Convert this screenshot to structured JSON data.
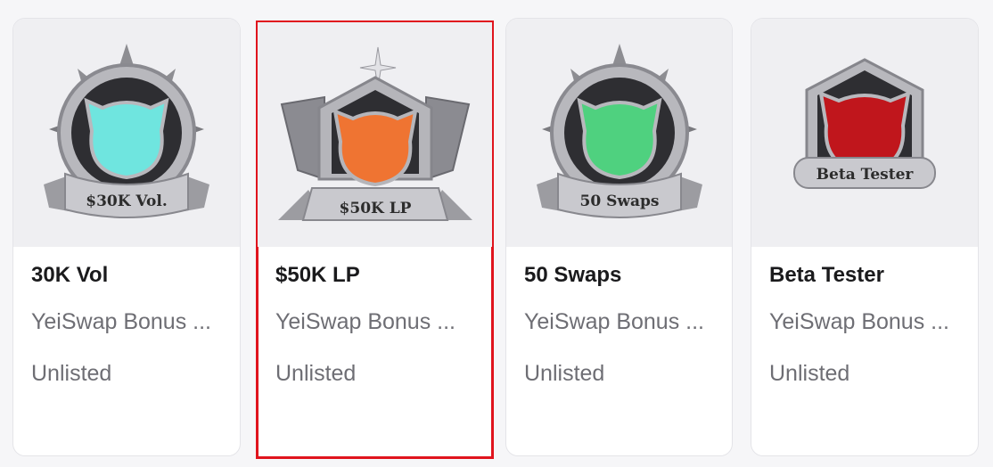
{
  "cards": [
    {
      "name": "30K Vol",
      "collection": "YeiSwap Bonus ...",
      "status": "Unlisted",
      "badge_text": "$30K Vol.",
      "badge_color": "#6fe5df",
      "selected": false
    },
    {
      "name": "$50K LP",
      "collection": "YeiSwap Bonus ...",
      "status": "Unlisted",
      "badge_text": "$50K LP",
      "badge_color": "#ef7432",
      "selected": true
    },
    {
      "name": "50 Swaps",
      "collection": "YeiSwap Bonus ...",
      "status": "Unlisted",
      "badge_text": "50 Swaps",
      "badge_color": "#4fd17f",
      "selected": false
    },
    {
      "name": "Beta Tester",
      "collection": "YeiSwap Bonus ...",
      "status": "Unlisted",
      "badge_text": "Beta Tester",
      "badge_color": "#c0161c",
      "selected": false
    }
  ],
  "colors": {
    "selection_outline": "#e0141d",
    "card_media_bg": "#efeff2",
    "text_secondary": "#6e6e74"
  }
}
